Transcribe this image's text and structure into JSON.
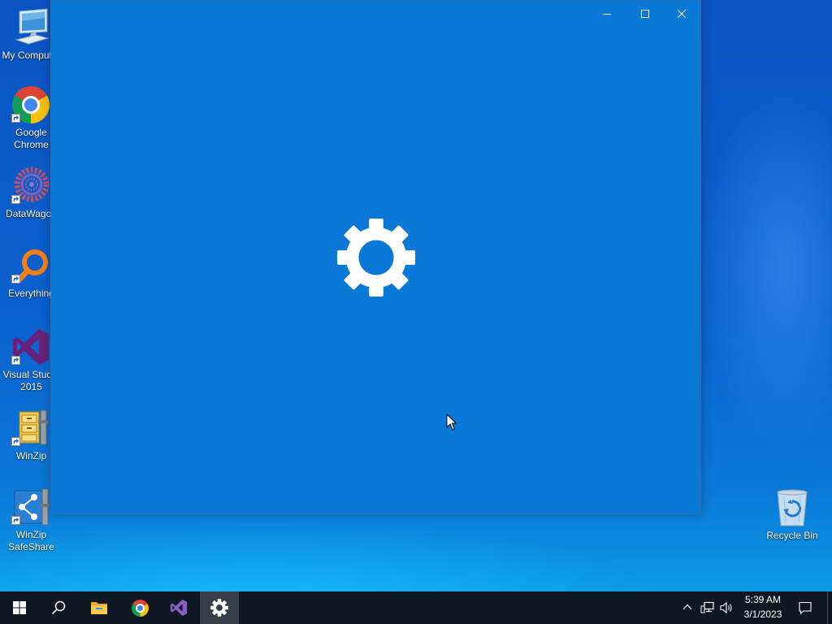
{
  "desktop": {
    "icons": [
      {
        "lines": [
          "My Computer"
        ],
        "icon": "computer-icon"
      },
      {
        "lines": [
          "Google",
          "Chrome"
        ],
        "icon": "chrome-icon",
        "shortcut": true
      },
      {
        "lines": [
          "DataWagon"
        ],
        "icon": "datawagon-icon",
        "shortcut": true
      },
      {
        "lines": [
          "Everything"
        ],
        "icon": "everything-icon",
        "shortcut": true
      },
      {
        "lines": [
          "Visual Studio",
          "2015"
        ],
        "icon": "visual-studio-icon",
        "shortcut": true
      },
      {
        "lines": [
          "WinZip"
        ],
        "icon": "winzip-icon",
        "shortcut": true
      },
      {
        "lines": [
          "WinZip",
          "SafeShare"
        ],
        "icon": "winzip-safeshare-icon",
        "shortcut": true
      }
    ],
    "recycle_bin": {
      "lines": [
        "Recycle Bin"
      ],
      "icon": "recycle-bin-icon"
    }
  },
  "window": {
    "background": "#0a78d7",
    "controls": [
      "minimize-icon",
      "maximize-icon",
      "close-icon"
    ],
    "splash_icon": "gear-icon"
  },
  "taskbar": {
    "background": "#0f1822",
    "apps": [
      {
        "icon": "windows-start-icon"
      },
      {
        "icon": "search-icon"
      },
      {
        "icon": "file-explorer-icon"
      },
      {
        "icon": "chrome-icon"
      },
      {
        "icon": "visual-studio-icon"
      },
      {
        "icon": "settings-gear-icon",
        "active": true
      }
    ],
    "tray": {
      "icons": [
        "chevron-up-icon",
        "network-icon",
        "volume-icon"
      ],
      "time": "5:39 AM",
      "date": "3/1/2023",
      "notification_icon": "action-center-icon"
    }
  }
}
